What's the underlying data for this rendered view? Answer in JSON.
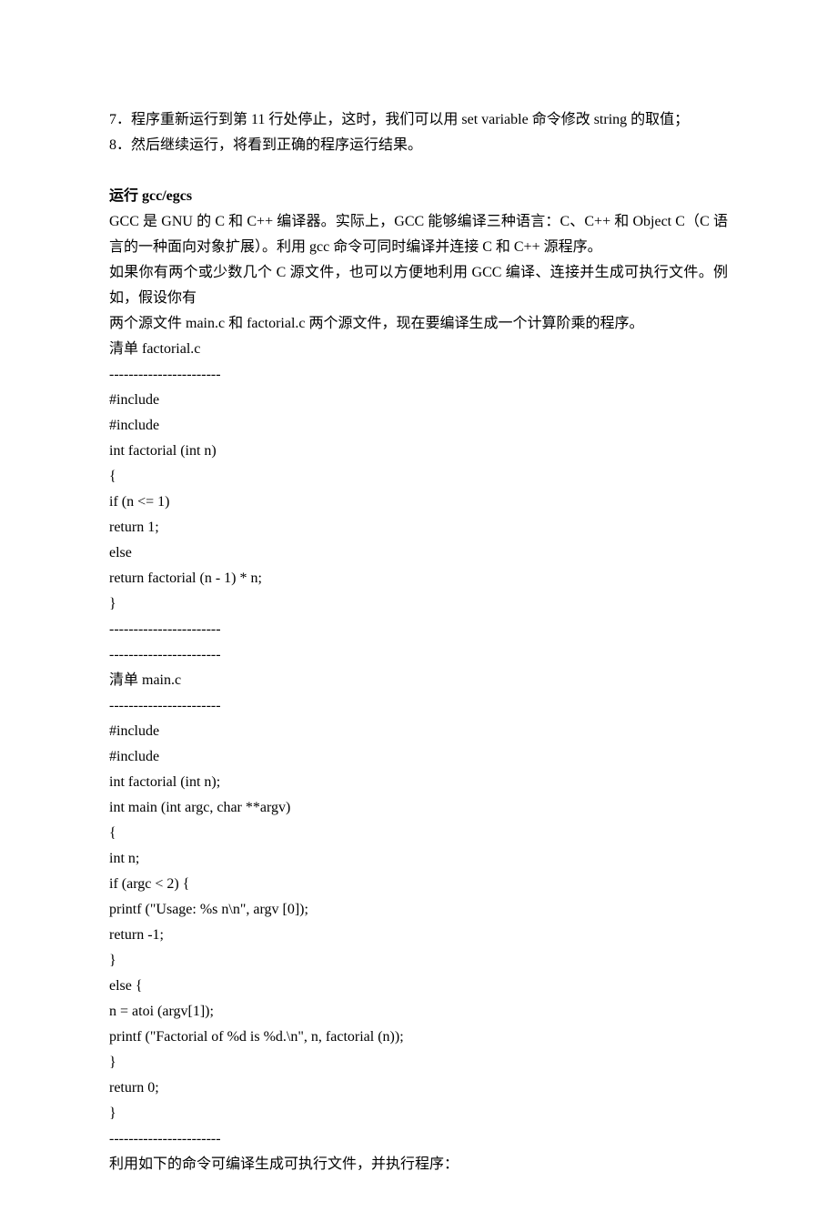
{
  "lines": [
    "7．程序重新运行到第 11 行处停止，这时，我们可以用 set variable 命令修改 string 的取值；",
    "8．然后继续运行，将看到正确的程序运行结果。"
  ],
  "heading": "运行 gcc/egcs",
  "body_lines": [
    "GCC 是 GNU 的 C 和 C++ 编译器。实际上，GCC 能够编译三种语言：C、C++ 和 Object C（C 语言的一种面向对象扩展）。利用 gcc 命令可同时编译并连接 C 和 C++ 源程序。",
    "如果你有两个或少数几个 C 源文件，也可以方便地利用 GCC 编译、连接并生成可执行文件。例如，假设你有",
    "两个源文件 main.c 和 factorial.c 两个源文件，现在要编译生成一个计算阶乘的程序。",
    "清单 factorial.c",
    "-----------------------",
    "#include",
    "#include",
    "int factorial (int n)",
    "{",
    "if (n <= 1)",
    "return 1;",
    "else",
    "return factorial (n - 1) * n;",
    "}",
    "-----------------------",
    "-----------------------",
    "清单 main.c",
    "-----------------------",
    "#include",
    "#include",
    "int factorial (int n);",
    "int main (int argc, char **argv)",
    "{",
    "int n;",
    "if (argc < 2) {",
    "printf (\"Usage: %s n\\n\", argv [0]);",
    "return -1;",
    "}",
    "else {",
    "n = atoi (argv[1]);",
    "printf (\"Factorial of %d is %d.\\n\", n, factorial (n));",
    "}",
    "return 0;",
    "}",
    "-----------------------",
    "利用如下的命令可编译生成可执行文件，并执行程序："
  ]
}
